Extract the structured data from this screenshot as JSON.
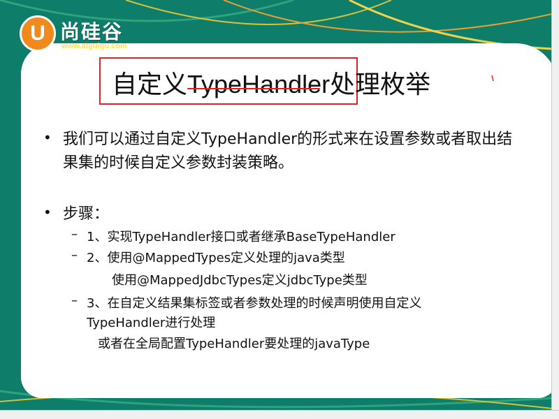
{
  "logo": {
    "letter": "U",
    "name": "尚硅谷",
    "url": "www.atguigu.com"
  },
  "slide": {
    "title": "自定义TypeHandler处理枚举",
    "bullets": [
      {
        "text": "我们可以通过自定义TypeHandler的形式来在设置参数或者取出结果集的时候自定义参数封装策略。"
      },
      {
        "text": "步骤：",
        "steps": [
          "1、实现TypeHandler接口或者继承BaseTypeHandler",
          "2、使用@MappedTypes定义处理的java类型",
          "使用@MappedJdbcTypes定义jdbcType类型",
          "3、在自定义结果集标签或者参数处理的时候声明使用自定义",
          "TypeHandler进行处理",
          "或者在全局配置TypeHandler要处理的javaType"
        ]
      }
    ]
  },
  "colors": {
    "background_green": "#0e7d6a",
    "accent_yellow": "#ffe14a",
    "logo_orange": "#f08a1c",
    "highlight_red": "#e02020"
  }
}
